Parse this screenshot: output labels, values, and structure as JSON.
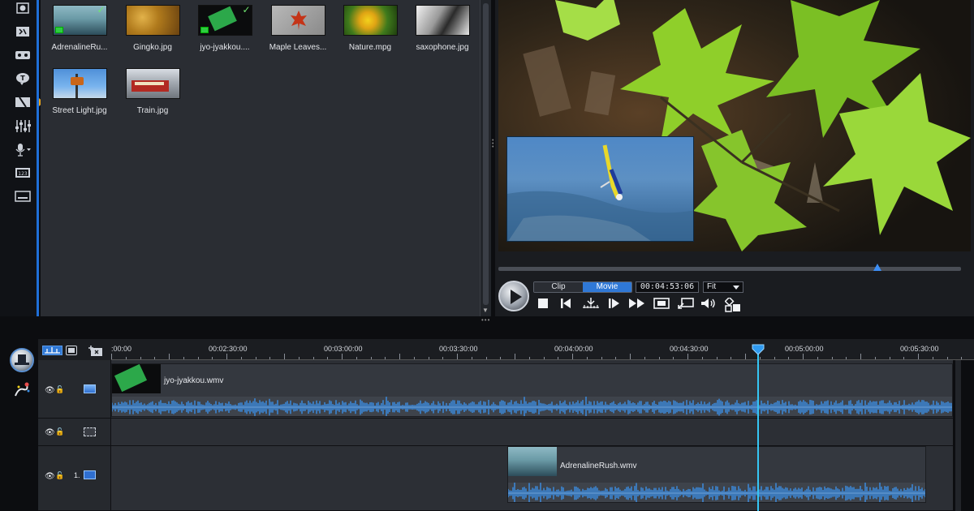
{
  "library": {
    "items": [
      {
        "label": "AdrenalineRu...",
        "checked": true,
        "kind": "video"
      },
      {
        "label": "Gingko.jpg",
        "checked": false,
        "kind": "image"
      },
      {
        "label": "jyo-jyakkou....",
        "checked": true,
        "kind": "video"
      },
      {
        "label": "Maple Leaves...",
        "checked": false,
        "kind": "image"
      },
      {
        "label": "Nature.mpg",
        "checked": false,
        "kind": "video"
      },
      {
        "label": "saxophone.jpg",
        "checked": false,
        "kind": "image"
      },
      {
        "label": "Street Light.jpg",
        "checked": false,
        "kind": "image"
      },
      {
        "label": "Train.jpg",
        "checked": false,
        "kind": "image"
      }
    ],
    "check_glyph": "✓"
  },
  "rail": {
    "icons": [
      "media-room-icon",
      "fx-room-icon",
      "pip-objects-icon",
      "title-room-icon",
      "transition-room-icon",
      "audio-mixing-icon",
      "voice-over-icon",
      "chapter-room-icon",
      "subtitle-room-icon"
    ]
  },
  "preview": {
    "mode_clip": "Clip",
    "mode_movie": "Movie",
    "active_mode": "Movie",
    "timecode": "00:04:53:06",
    "zoom": "Fit",
    "scrub_position": 0.82
  },
  "timeline": {
    "ruler": [
      ":00:00",
      "00:02:30:00",
      "00:03:00:00",
      "00:03:30:00",
      "00:04:00:00",
      "00:04:30:00",
      "00:05:00:00",
      "00:05:30:00"
    ],
    "track1_clip": "jyo-jyakkou.wmv",
    "track3_clip": "AdrenalineRush.wmv",
    "track3_index": "1.",
    "accent": "#35c6f4",
    "wave_color": "#3b8fe6"
  }
}
